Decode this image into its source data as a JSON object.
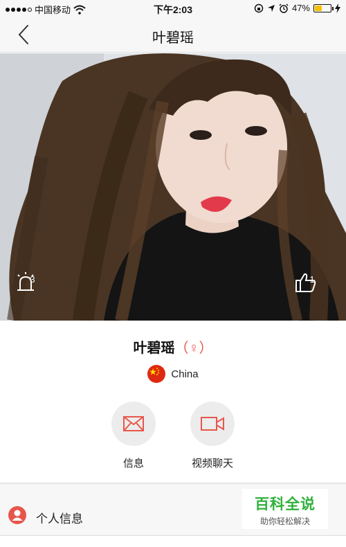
{
  "status_bar": {
    "carrier": "中国移动",
    "time": "下午2:03",
    "battery_text": "47%",
    "battery_level": 0.47,
    "battery_color": "#f5c000",
    "signal_bars": 4,
    "icons": [
      "wifi-icon",
      "orientation-lock-icon",
      "location-icon",
      "alarm-icon",
      "battery-icon",
      "charging-icon"
    ]
  },
  "nav": {
    "title": "叶碧瑶",
    "back_icon": "chevron-left-icon"
  },
  "photo": {
    "report": {
      "icon": "alarm-light-icon",
      "count": "3"
    },
    "like": {
      "icon": "thumbs-up-icon",
      "count": "1"
    }
  },
  "profile": {
    "name": "叶碧瑶",
    "gender": "（♀）",
    "country": "China",
    "flag_icon": "china-flag-icon",
    "accent_color": "#e8564b"
  },
  "actions": [
    {
      "label": "信息",
      "icon": "envelope-icon"
    },
    {
      "label": "视频聊天",
      "icon": "video-camera-icon"
    }
  ],
  "section": {
    "title": "个人信息",
    "icon": "person-icon"
  },
  "watermark": {
    "title": "百科全说",
    "subtitle": "助你轻松解决",
    "color": "#2fb13a"
  }
}
